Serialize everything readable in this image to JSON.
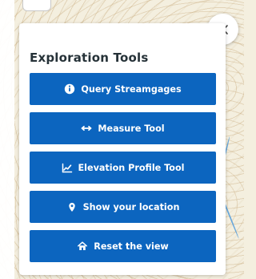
{
  "panel": {
    "title": "Exploration Tools"
  },
  "buttons": [
    {
      "label": "Query Streamgages",
      "icon": "info-circle-icon"
    },
    {
      "label": "Measure Tool",
      "icon": "arrows-horizontal-icon"
    },
    {
      "label": "Elevation Profile Tool",
      "icon": "line-chart-icon"
    },
    {
      "label": "Show your location",
      "icon": "location-pin-icon"
    },
    {
      "label": "Reset the view",
      "icon": "home-icon"
    }
  ],
  "controls": {
    "close_icon": "close-icon"
  },
  "colors": {
    "button_blue": "#0c65bf",
    "panel_white": "#ffffff",
    "title_text": "#263238"
  }
}
